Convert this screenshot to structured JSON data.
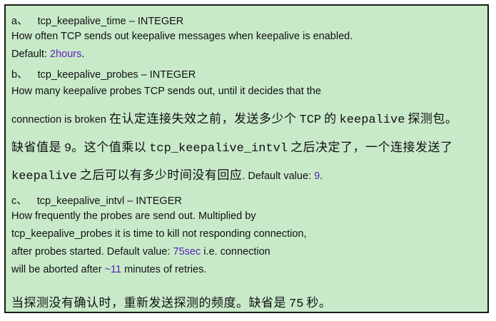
{
  "colors": {
    "background": "#c8eac9",
    "border": "#1a1a1a",
    "value": "#5b21b6",
    "text": "#111111"
  },
  "a": {
    "marker": "a、",
    "name": "tcp_keepalive_time – INTEGER",
    "desc": "How often TCP sends out keepalive messages when keepalive is enabled.",
    "default_label": "Default: ",
    "default_value": "2hours",
    "default_tail": "."
  },
  "b": {
    "marker": "b、",
    "name": "tcp_keepalive_probes – INTEGER",
    "desc1": "How many keepalive probes TCP sends out, until it decides that the",
    "desc2_en": "connection is broken",
    "desc2_cn1": "在认定连接失效之前，发送多少个",
    "desc2_tcp": "TCP",
    "desc2_cn2": "的",
    "desc2_kw": "keepalive",
    "desc2_cn3": "探测包。",
    "desc3_cn1": "缺省值是",
    "desc3_num": "9",
    "desc3_cn2": "。这个值乘以",
    "desc3_kw": "tcp_keepalive_intvl",
    "desc3_cn3": "之后决定了，一个连接发送了",
    "desc4_kw": "keepalive",
    "desc4_cn": "之后可以有多少时间没有回应",
    "default_label": ". Default value: ",
    "default_value": "9",
    "default_tail": "."
  },
  "c": {
    "marker": "c、",
    "name": "tcp_keepalive_intvl – INTEGER",
    "desc1": "How frequently the probes are send out. Multiplied by",
    "desc2": "tcp_keepalive_probes it is time to kill not responding connection,",
    "desc3_pre": "after probes started. Default value: ",
    "desc3_value": "75sec",
    "desc3_post": " i.e. connection",
    "desc4_pre": "will be aborted after ",
    "desc4_value": "~11",
    "desc4_post": " minutes of retries.",
    "cn": "当探测没有确认时，重新发送探测的频度。缺省是",
    "cn_num": "75",
    "cn_tail": "秒。"
  }
}
